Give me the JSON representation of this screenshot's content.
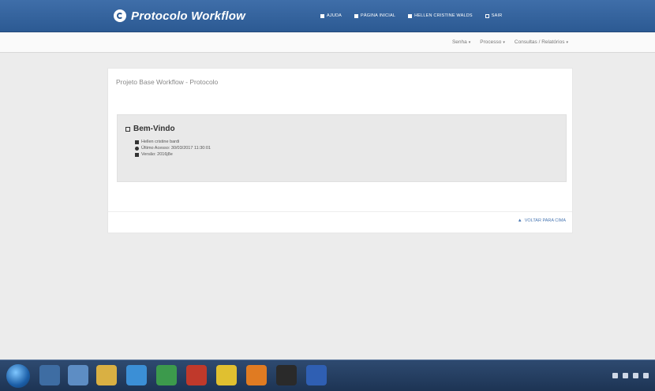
{
  "header": {
    "brand": "Protocolo Workflow",
    "links": [
      {
        "label": "AJUDA",
        "icon": "help-icon"
      },
      {
        "label": "PÁGINA INICIAL",
        "icon": "home-icon"
      },
      {
        "label": "HELLEN CRISTINE WALDS",
        "icon": "user-icon"
      },
      {
        "label": "SAIR",
        "icon": "logout-icon"
      }
    ]
  },
  "subnav": {
    "items": [
      "Senha",
      "Processo",
      "Consultas / Relatórios"
    ]
  },
  "panel": {
    "title": "Projeto Base Workflow - Protocolo",
    "welcome": {
      "heading": "Bem-Vindo",
      "user": "Hellen cristine bardi",
      "last_access": "Último Acesso: 30/03/2017 11:30:01",
      "version": "Versão: 2016j8e"
    },
    "footer_link": "VOLTAR PARA CIMA"
  },
  "taskbar": {
    "icons": [
      "windows-start-icon",
      "media-player-icon",
      "library-icon",
      "folder-icon",
      "ie-icon",
      "excel-icon",
      "pdf-icon",
      "chrome-icon",
      "firefox-icon",
      "terminal-icon",
      "word-icon"
    ],
    "colors": [
      "#1c5fa8",
      "#3e6da3",
      "#5d8dc4",
      "#d9b043",
      "#3b8fd6",
      "#3c9a4c",
      "#c0392b",
      "#e0c030",
      "#e07b22",
      "#2a2a2a",
      "#2f5fb3"
    ]
  }
}
